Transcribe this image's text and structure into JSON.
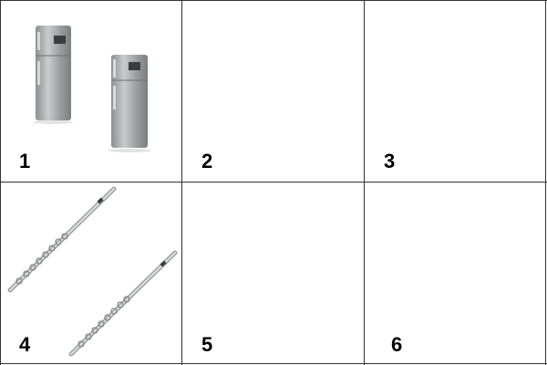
{
  "cells": [
    {
      "number": "1",
      "image": "refrigerator-pair-icon"
    },
    {
      "number": "2",
      "image": ""
    },
    {
      "number": "3",
      "image": ""
    },
    {
      "number": "4",
      "image": "flute-pair-icon"
    },
    {
      "number": "5",
      "image": ""
    },
    {
      "number": "6",
      "image": ""
    }
  ],
  "colors": {
    "grid_line": "#333333",
    "background": "#ffffff",
    "number_text": "#000000",
    "appliance_silver": "#a7aaad",
    "flute_silver": "#b9bcbf"
  }
}
